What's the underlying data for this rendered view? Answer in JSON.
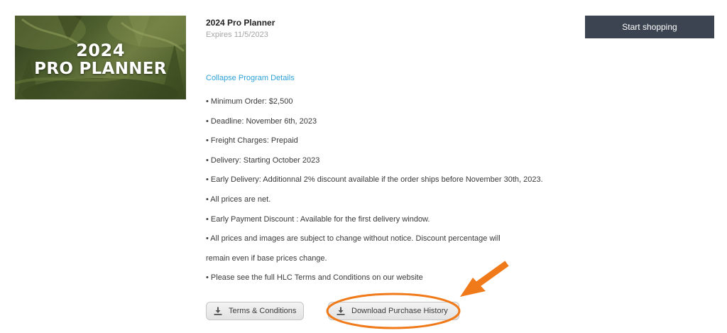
{
  "banner": {
    "year": "2024",
    "name": "PRO PLANNER"
  },
  "program": {
    "title": "2024 Pro Planner",
    "expiry": "Expires 11/5/2023",
    "collapse_link": "Collapse Program Details",
    "details": [
      "• Minimum Order: $2,500",
      "• Deadline: November 6th, 2023",
      "• Freight Charges: Prepaid",
      "• Delivery: Starting October 2023",
      "• Early Delivery: Additionnal 2% discount available if the order ships before November 30th, 2023.",
      "• All prices are net.",
      "• Early Payment Discount : Available for the first delivery window.",
      "• All prices and images are subject to change without notice. Discount percentage will",
      "remain even if base prices change.",
      "• Please see the full HLC Terms and Conditions on our website"
    ]
  },
  "buttons": {
    "terms": "Terms & Conditions",
    "download_history": "Download Purchase History",
    "start_shopping": "Start shopping"
  },
  "icons": {
    "terms": "download-icon",
    "download_history": "download-icon"
  },
  "colors": {
    "link": "#2da1d8",
    "primary_button": "#3b4450",
    "annotation": "#f07a1a"
  }
}
